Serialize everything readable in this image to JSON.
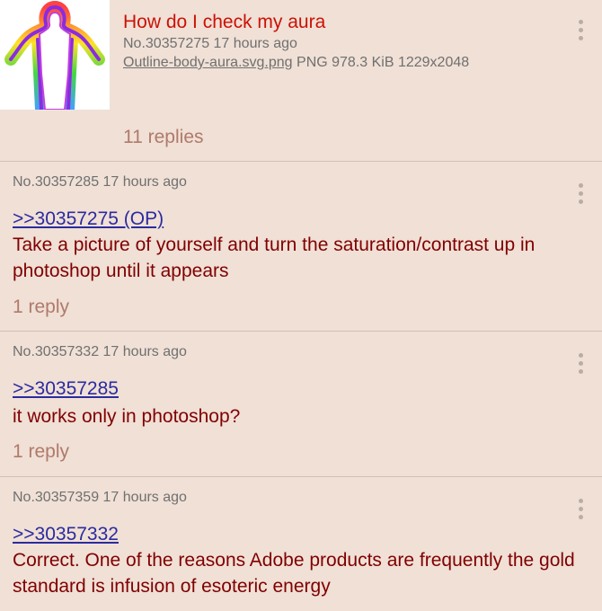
{
  "op": {
    "thumbnail_icon": "aura-body-thumbnail",
    "subject": "How do I check my aura",
    "meta": "No.30357275 17 hours ago",
    "file_name": "Outline-body-aura.svg.png",
    "file_info": "PNG 978.3 KiB 1229x2048",
    "replies": "11 replies"
  },
  "posts": [
    {
      "meta": "No.30357285 17 hours ago",
      "quote": ">>30357275 (OP)",
      "body": "Take a picture of yourself and turn the saturation/contrast up in photoshop until it appears",
      "replies": "1 reply"
    },
    {
      "meta": "No.30357332 17 hours ago",
      "quote": ">>30357285",
      "body": "it works only in photoshop?",
      "replies": "1 reply"
    },
    {
      "meta": "No.30357359 17 hours ago",
      "quote": ">>30357332",
      "body": "Correct. One of the reasons Adobe products are frequently the gold standard is infusion of esoteric energy"
    }
  ],
  "colors": {
    "background": "#f0e0d6",
    "subject": "#cc1105",
    "body_text": "#800000",
    "quote_link": "#2b2b9f",
    "reply_count": "#b07a6a"
  }
}
